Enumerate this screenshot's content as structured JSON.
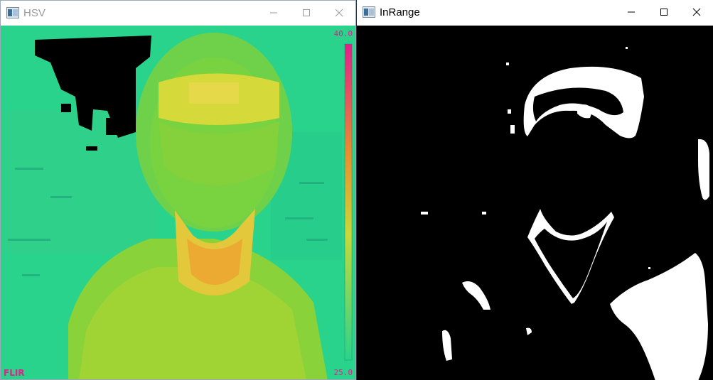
{
  "windows": {
    "hsv": {
      "title": "HSV",
      "overlay": {
        "brand": "FLIR",
        "temp_max": "40.0",
        "temp_min": "25.0"
      }
    },
    "inrange": {
      "title": "InRange"
    }
  },
  "colors": {
    "titlebar_bg": "#ffffff",
    "hsv_base": "#2ad38c",
    "hsv_body": "#8ad23a",
    "hsv_hot": "#e9d93a",
    "hsv_hottest": "#f0a030",
    "mask_white": "#ffffff",
    "mask_black": "#000000",
    "overlay_pink": "#e0208c"
  },
  "icons": {
    "window_app": "opencv-window-icon",
    "minimize": "minimize-icon",
    "maximize": "maximize-icon",
    "close": "close-icon"
  }
}
